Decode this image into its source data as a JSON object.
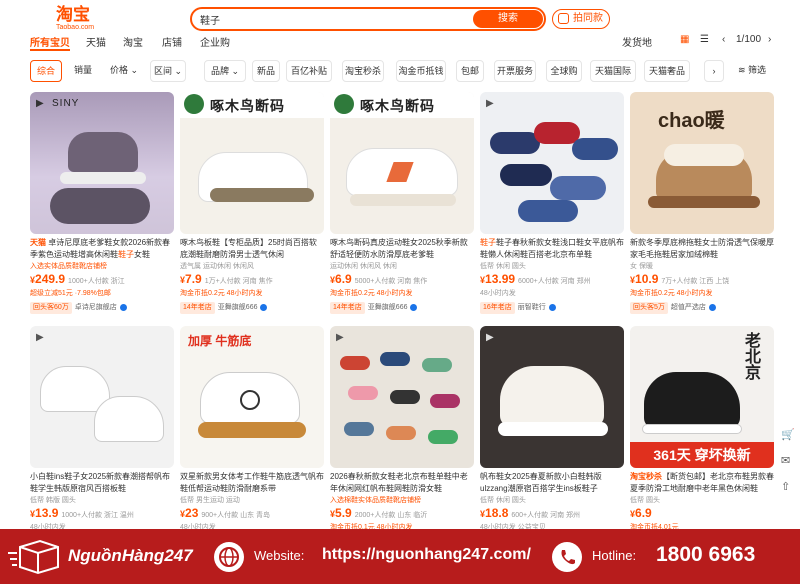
{
  "header": {
    "logo_cn": "淘宝",
    "logo_en": "Taobao.com",
    "search_value": "鞋子",
    "search_button": "搜索",
    "photo_search": "拍同款",
    "colors": {
      "accent": "#ff5000"
    }
  },
  "tabs": [
    "所有宝贝",
    "天猫",
    "淘宝",
    "店铺",
    "企业购"
  ],
  "tabs_right": {
    "delivery": "发货地",
    "page": "1/100"
  },
  "filters": [
    "综合",
    "销量",
    "价格",
    "区间",
    "品牌",
    "新品",
    "百亿补贴",
    "淘宝秒杀",
    "淘金币抵钱",
    "包邮",
    "开票服务",
    "全球购",
    "天猫国际",
    "天猫奢品",
    "筛选"
  ],
  "products": [
    {
      "tag": "天猫",
      "title": "卓诗尼厚底老爹鞋女款2026新款春季紫色运动鞋增高休闲鞋",
      "title_hl": "鞋子",
      "title_end": "女鞋",
      "img_text": "SINY",
      "sub_tag": "入选实体品质鞋靴店铺榜",
      "price_int": "249.9",
      "meta": "1000+人付款 浙江",
      "sub": "超级立减51元 ·7.98%包邮",
      "badge": "回头客60万",
      "shop": "卓诗尼旗舰店"
    },
    {
      "tag": "",
      "title": "啄木鸟板鞋【专柜品质】25时尚百搭软底潮鞋耐磨防滑男士透气休闲",
      "img_text": "啄木鸟断码",
      "sub_tag": "透气属 运动休闲 休闲风",
      "price_int": "7.9",
      "meta": "1万+人付款 河南 焦作",
      "sub": "淘金币抵0.2元 48小时内发",
      "badge": "14年老店",
      "shop": "亚舞旗舰666"
    },
    {
      "tag": "",
      "title": "啄木鸟断码真皮运动鞋女2025秋季新款舒适轻便防水防滑厚底老爹鞋",
      "img_text": "啄木鸟断码",
      "sub_tag": "运动休闲 休闲风 休闲",
      "price_int": "6.9",
      "meta": "5000+人付款 河南 焦作",
      "sub": "淘金币抵0.2元 48小时内发",
      "badge": "14年老店",
      "shop": "亚舞旗舰666"
    },
    {
      "tag": "",
      "title": "鞋子春秋新款女鞋浅口鞋女平底帆布鞋懒人休闲鞋百搭老北京布单鞋",
      "title_hl": "鞋子",
      "img_text": "",
      "sub_tag": "低帮 休闲 圆头",
      "price_int": "13.99",
      "meta": "6000+人付款 河南 郑州",
      "sub": "48小时内发",
      "badge": "16年老店",
      "shop": "丽智鞋行"
    },
    {
      "tag": "",
      "title": "新款冬季厚底棉拖鞋女士防滑透气保暖厚家毛毛拖鞋居家加绒棉鞋",
      "img_text": "chao暖",
      "sub_tag": "女 保暖",
      "price_int": "10.9",
      "meta": "7万+人付款 江西 上饶",
      "sub": "淘金币抵0.2元 48小时内发",
      "badge": "回头客5万",
      "shop": "超值严选店"
    },
    {
      "tag": "",
      "title": "小白鞋ins鞋子女2025新款春潮搭帮帆布鞋学生韩版原宿风百搭板鞋",
      "title_hl": "鞋子",
      "img_text": "",
      "sub_tag": "低帮 韩版 圆头",
      "price_int": "13.9",
      "meta": "1000+人付款 浙江 温州",
      "sub": "48小时内发",
      "badge": "",
      "shop": ""
    },
    {
      "tag": "",
      "title": "双星新款男女体考工作鞋牛筋底透气帆布鞋低帮运动鞋防滑耐磨系带",
      "img_text": "加厚 牛筋底",
      "sub_tag": "低帮 男生运动 运动",
      "price_int": "23",
      "meta": "900+人付款 山东 青岛",
      "sub": "48小时内发",
      "badge": "",
      "shop": ""
    },
    {
      "tag": "",
      "title": "2026春秋新款女鞋老北京布鞋单鞋中老年休闲网红帆布鞋网鞋防滑女鞋",
      "img_text": "",
      "sub_tag": "入选棉鞋实体品质鞋靴店铺榜",
      "price_int": "5.9",
      "meta": "2000+人付款 山东 临沂",
      "sub": "淘金币抵0.1元 48小时内发",
      "badge": "",
      "shop": ""
    },
    {
      "tag": "",
      "title": "帆布鞋女2025春夏新款小白鞋韩版ulzzang潮原宿百搭学生ins板鞋子",
      "title_hl": "鞋子",
      "img_text": "",
      "sub_tag": "低帮 休闲 圆头",
      "price_int": "18.8",
      "meta": "600+人付款 河南 郑州",
      "sub": "48小时内发 公益宝贝",
      "badge": "",
      "shop": ""
    },
    {
      "tag": "淘宝秒杀",
      "title": "【断货包邮】老北京布鞋男款春夏季防滑工地耐磨中老年黑色休闲鞋",
      "img_text": "361天 穿坏换新",
      "sub_tag": "低帮 圆头",
      "price_int": "6.9",
      "meta": "",
      "sub": "淘金币抵4.01元",
      "badge": "",
      "shop": ""
    }
  ],
  "footer": {
    "brand": "NguồnHàng247",
    "website_label": "Website:",
    "website": "https://nguonhang247.com/",
    "hotline_label": "Hotline:",
    "hotline": "1800 6963",
    "colors": {
      "bg": "#b71c1c"
    }
  }
}
